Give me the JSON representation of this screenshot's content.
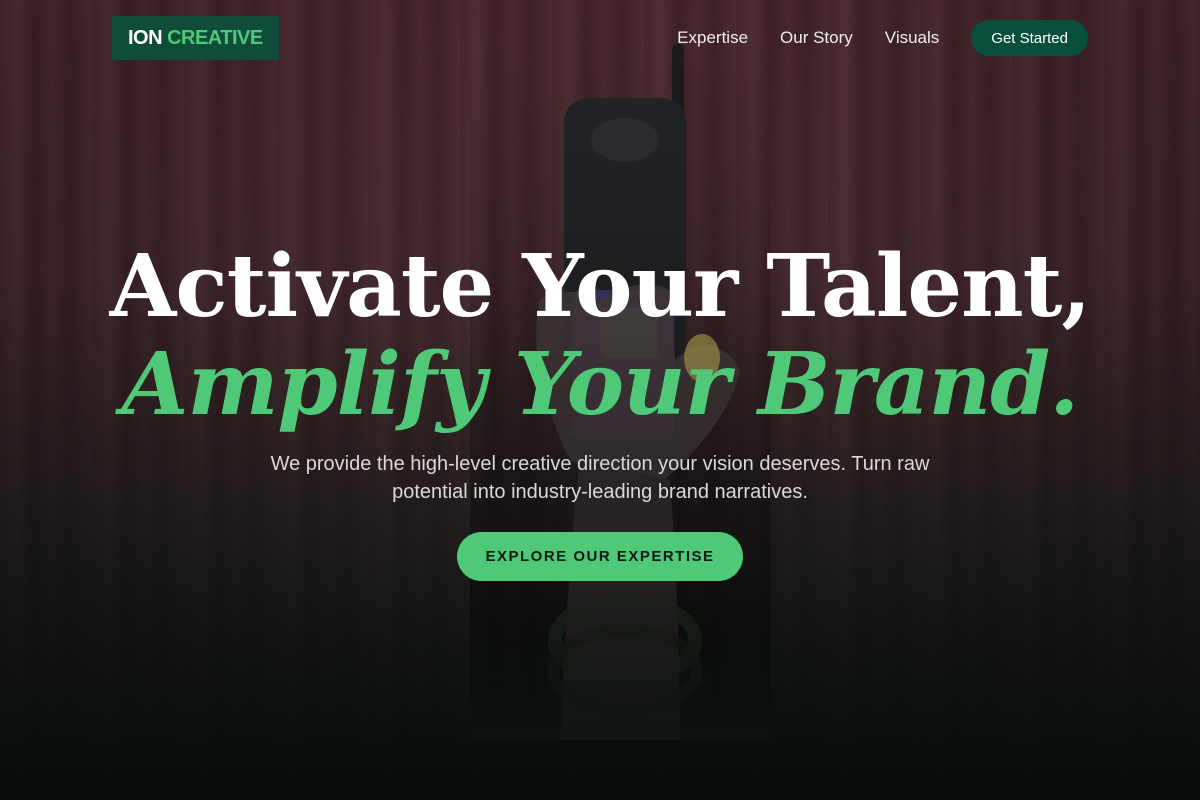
{
  "nav": {
    "logo_part1": "ION",
    "logo_part2": "CREATIVE",
    "links": [
      "Expertise",
      "Our Story",
      "Visuals"
    ],
    "cta": "Get Started"
  },
  "hero": {
    "headline_line1": "Activate Your Talent,",
    "headline_line2": "Amplify Your Brand.",
    "subtitle": "We provide the high-level creative direction your vision deserves. Turn raw potential into industry-leading brand narratives.",
    "cta": "EXPLORE OUR EXPERTISE"
  },
  "colors": {
    "accent": "#4fc978",
    "brand_dark": "#0a4f3c",
    "background": "#0b1210"
  },
  "icons": {
    "hero_image": "hand-holding-phone-illustration"
  }
}
